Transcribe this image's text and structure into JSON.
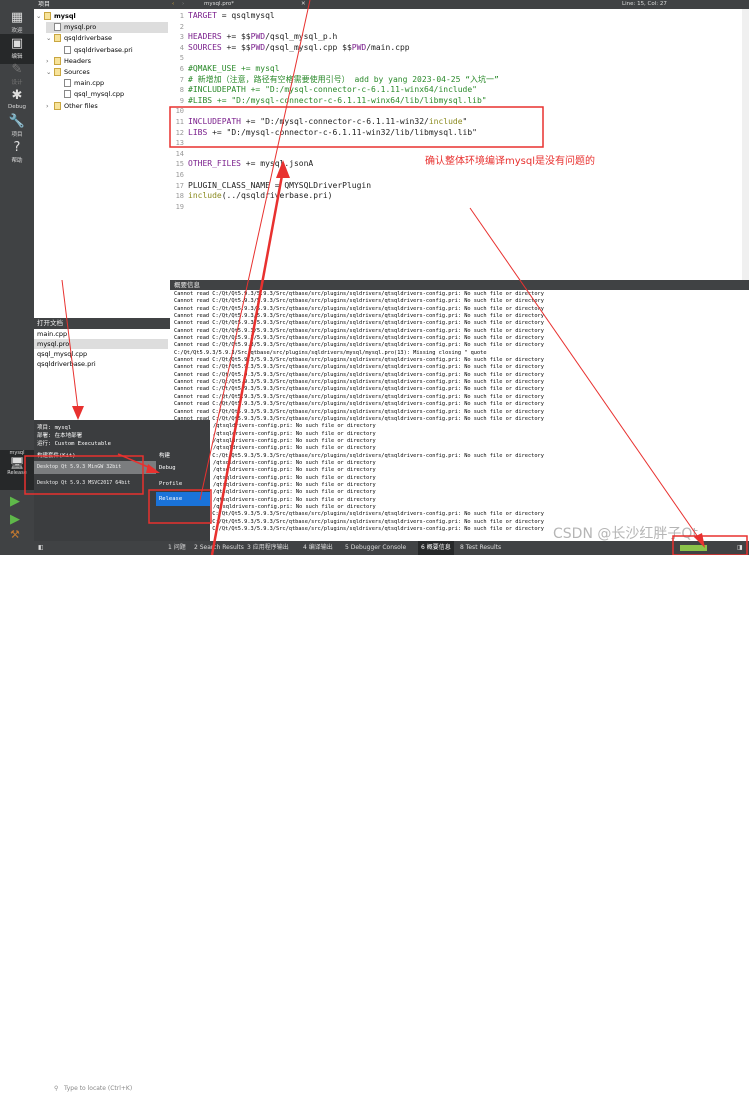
{
  "modebar": {
    "items": [
      {
        "label": "欢迎",
        "icon": "grid-icon"
      },
      {
        "label": "编辑",
        "icon": "edit-icon"
      },
      {
        "label": "设计",
        "icon": "pencil-icon"
      },
      {
        "label": "Debug",
        "icon": "bug-icon"
      },
      {
        "label": "项目",
        "icon": "wrench-icon"
      },
      {
        "label": "帮助",
        "icon": "help-icon"
      }
    ],
    "kit_label": "mysql",
    "kit_mode": "Release"
  },
  "project": {
    "header": "项目",
    "tree": [
      {
        "label": "mysql",
        "bold": true
      },
      {
        "label": "mysql.pro"
      },
      {
        "label": "qsqldriverbase"
      },
      {
        "label": "qsqldriverbase.pri"
      },
      {
        "label": "Headers"
      },
      {
        "label": "Sources"
      },
      {
        "label": "main.cpp"
      },
      {
        "label": "qsql_mysql.cpp"
      },
      {
        "label": "Other files"
      }
    ]
  },
  "open_docs": {
    "header": "打开文档",
    "items": [
      "main.cpp",
      "mysql.pro",
      "qsql_mysql.cpp",
      "qsqldriverbase.pri"
    ],
    "selected": 1
  },
  "editor": {
    "file_tab": "mysql.pro*",
    "position": "Line: 15, Col: 27",
    "lines": [
      [
        [
          "TARGET",
          "k"
        ],
        [
          " = qsqlmysql",
          "s"
        ]
      ],
      [],
      [
        [
          "HEADERS",
          "k"
        ],
        [
          " += $$",
          "s"
        ],
        [
          "PWD",
          "k"
        ],
        [
          "/qsql_mysql_p.h",
          "s"
        ]
      ],
      [
        [
          "SOURCES",
          "k"
        ],
        [
          " += $$",
          "s"
        ],
        [
          "PWD",
          "k"
        ],
        [
          "/qsql_mysql.cpp $$",
          "s"
        ],
        [
          "PWD",
          "k"
        ],
        [
          "/main.cpp",
          "s"
        ]
      ],
      [],
      [
        [
          "#QMAKE_USE += mysql",
          "c"
        ]
      ],
      [
        [
          "# 新增加（注意，路径有空格需要使用引号） add by yang 2023-04-25 “入坑一”",
          "c"
        ]
      ],
      [
        [
          "#INCLUDEPATH += \"D:/mysql-connector-c-6.1.11-winx64/include\"",
          "c"
        ]
      ],
      [
        [
          "#LIBS += \"D:/mysql-connector-c-6.1.11-winx64/lib/libmysql.lib\"",
          "c"
        ]
      ],
      [],
      [
        [
          "INCLUDEPATH",
          "k"
        ],
        [
          " += \"D:/mysql-connector-c-6.1.11-win32/",
          "s"
        ],
        [
          "include",
          "o"
        ],
        [
          "\"",
          "s"
        ]
      ],
      [
        [
          "LIBS",
          "k"
        ],
        [
          " += \"D:/mysql-connector-c-6.1.11-win32/lib/libmysql.lib\"",
          "s"
        ]
      ],
      [],
      [],
      [
        [
          "OTHER_FILES",
          "k"
        ],
        [
          " += mysql.jsonA",
          "s"
        ]
      ],
      [],
      [
        [
          "PLUGIN_CLASS_NAME",
          "s"
        ],
        [
          " = QMYSQLDriverPlugin",
          "s"
        ]
      ],
      [
        [
          "include",
          "o"
        ],
        [
          "(../qsqldriverbase.pri)",
          "s"
        ]
      ],
      []
    ]
  },
  "annotation": "确认整体环境编译mysql是没有问题的",
  "output": {
    "header": "概要信息",
    "lines": [
      "Cannot read C:/Qt/Qt5.9.3/5.9.3/Src/qtbase/src/plugins/sqldrivers/qtsqldrivers-config.pri: No such file or directory",
      "Cannot read C:/Qt/Qt5.9.3/5.9.3/Src/qtbase/src/plugins/sqldrivers/qtsqldrivers-config.pri: No such file or directory",
      "Cannot read C:/Qt/Qt5.9.3/5.9.3/Src/qtbase/src/plugins/sqldrivers/qtsqldrivers-config.pri: No such file or directory",
      "Cannot read C:/Qt/Qt5.9.3/5.9.3/Src/qtbase/src/plugins/sqldrivers/qtsqldrivers-config.pri: No such file or directory",
      "Cannot read C:/Qt/Qt5.9.3/5.9.3/Src/qtbase/src/plugins/sqldrivers/qtsqldrivers-config.pri: No such file or directory",
      "Cannot read C:/Qt/Qt5.9.3/5.9.3/Src/qtbase/src/plugins/sqldrivers/qtsqldrivers-config.pri: No such file or directory",
      "Cannot read C:/Qt/Qt5.9.3/5.9.3/Src/qtbase/src/plugins/sqldrivers/qtsqldrivers-config.pri: No such file or directory",
      "Cannot read C:/Qt/Qt5.9.3/5.9.3/Src/qtbase/src/plugins/sqldrivers/qtsqldrivers-config.pri: No such file or directory",
      "C:/Qt/Qt5.9.3/5.9.3/Src/qtbase/src/plugins/sqldrivers/mysql/mysql.pro(13): Missing closing \" quote",
      "Cannot read C:/Qt/Qt5.9.3/5.9.3/Src/qtbase/src/plugins/sqldrivers/qtsqldrivers-config.pri: No such file or directory",
      "Cannot read C:/Qt/Qt5.9.3/5.9.3/Src/qtbase/src/plugins/sqldrivers/qtsqldrivers-config.pri: No such file or directory",
      "Cannot read C:/Qt/Qt5.9.3/5.9.3/Src/qtbase/src/plugins/sqldrivers/qtsqldrivers-config.pri: No such file or directory",
      "Cannot read C:/Qt/Qt5.9.3/5.9.3/Src/qtbase/src/plugins/sqldrivers/qtsqldrivers-config.pri: No such file or directory",
      "Cannot read C:/Qt/Qt5.9.3/5.9.3/Src/qtbase/src/plugins/sqldrivers/qtsqldrivers-config.pri: No such file or directory",
      "Cannot read C:/Qt/Qt5.9.3/5.9.3/Src/qtbase/src/plugins/sqldrivers/qtsqldrivers-config.pri: No such file or directory",
      "Cannot read C:/Qt/Qt5.9.3/5.9.3/Src/qtbase/src/plugins/sqldrivers/qtsqldrivers-config.pri: No such file or directory",
      "Cannot read C:/Qt/Qt5.9.3/5.9.3/Src/qtbase/src/plugins/sqldrivers/qtsqldrivers-config.pri: No such file or directory",
      "Cannot read C:/Qt/Qt5.9.3/5.9.3/Src/qtbase/src/plugins/sqldrivers/qtsqldrivers-config.pri: No such file or directory",
      "/qtsqldrivers-config.pri: No such file or directory",
      "/qtsqldrivers-config.pri: No such file or directory",
      "/qtsqldrivers-config.pri: No such file or directory",
      "/qtsqldrivers-config.pri: No such file or directory",
      "Cannot read C:/Qt/Qt5.9.3/5.9.3/Src/qtbase/src/plugins/sqldrivers/qtsqldrivers-config.pri: No such file or directory",
      "/qtsqldrivers-config.pri: No such file or directory",
      "/qtsqldrivers-config.pri: No such file or directory",
      "/qtsqldrivers-config.pri: No such file or directory",
      "/qtsqldrivers-config.pri: No such file or directory",
      "/qtsqldrivers-config.pri: No such file or directory",
      "/qtsqldrivers-config.pri: No such file or directory",
      "/qtsqldrivers-config.pri: No such file or directory",
      "Cannot read C:/Qt/Qt5.9.3/5.9.3/Src/qtbase/src/plugins/sqldrivers/qtsqldrivers-config.pri: No such file or directory",
      "Cannot read C:/Qt/Qt5.9.3/5.9.3/Src/qtbase/src/plugins/sqldrivers/qtsqldrivers-config.pri: No such file or directory",
      "Cannot read C:/Qt/Qt5.9.3/5.9.3/Src/qtbase/src/plugins/sqldrivers/qtsqldrivers-config.pri: No such file or directory"
    ]
  },
  "kit_popup": {
    "project": "项目: mysql",
    "deploy": "部署: 在本地部署",
    "run": "运行: Custom Executable",
    "kits_header": "构建套件(Kit)",
    "build_header": "构建",
    "kits": [
      "Desktop Qt 5.9.3 MinGW 32bit",
      "Desktop Qt 5.9.3 MSVC2017 64bit"
    ],
    "builds": [
      "Debug",
      "Profile",
      "Release"
    ]
  },
  "status": {
    "locate_placeholder": "Type to locate (Ctrl+K)",
    "tabs": [
      "1 问题",
      "2 Search Results",
      "3 应用程序输出",
      "4 编译输出",
      "5 Debugger Console",
      "6 概要信息",
      "8 Test Results"
    ],
    "active_tab": 5,
    "progress": 1.0
  },
  "watermark": "CSDN @长沙红胖子Qt",
  "colors": {
    "annotation_red": "#e8312f",
    "selection_blue": "#1a73d9",
    "progress_green": "#8bc34a"
  }
}
